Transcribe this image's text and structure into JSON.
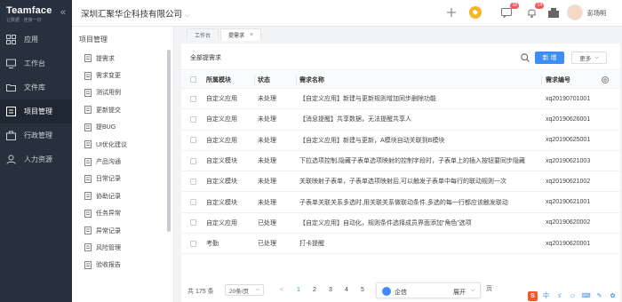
{
  "brand": {
    "name": "Teamface",
    "slogan": "让数据 · 连接一切"
  },
  "nav": {
    "items": [
      {
        "label": "应用",
        "icon": "grid-icon"
      },
      {
        "label": "工作台",
        "icon": "desktop-icon"
      },
      {
        "label": "文件库",
        "icon": "folder-icon"
      },
      {
        "label": "项目管理",
        "icon": "project-icon",
        "active": true
      },
      {
        "label": "行政管理",
        "icon": "admin-icon"
      },
      {
        "label": "人力资源",
        "icon": "people-icon"
      }
    ]
  },
  "topbar": {
    "company": "深圳汇聚华企科技有限公司",
    "badges": {
      "messages": "18",
      "notifications": "14"
    },
    "username": "彭场明"
  },
  "sub": {
    "title": "项目管理",
    "items": [
      "提需求",
      "需求变更",
      "测试用例",
      "更新提交",
      "提BUG",
      "UI优化建议",
      "产品沟通",
      "日常记录",
      "协助记录",
      "任务异常",
      "异常记录",
      "风险管理",
      "验收报告"
    ]
  },
  "tabs": [
    {
      "label": "工作台"
    },
    {
      "label": "提需求"
    }
  ],
  "panel": {
    "title": "全部提需求",
    "new_label": "新 增",
    "more_label": "更多"
  },
  "table": {
    "headers": {
      "module": "所属模块",
      "status": "状态",
      "name": "需求名称",
      "number": "需求编号"
    },
    "rows": [
      {
        "module": "自定义应用",
        "status": "未处理",
        "name": "【自定义应用】新建与更新规则增加同步删除功能",
        "number": "xq20190701001"
      },
      {
        "module": "自定义应用",
        "status": "未处理",
        "name": "【消息提醒】共享数据，无法提醒共享人",
        "number": "xq20190626001"
      },
      {
        "module": "自定义应用",
        "status": "未处理",
        "name": "【自定义应用】新建与更新，A模块自动关联到B模块",
        "number": "xq20190625001"
      },
      {
        "module": "自定义模块",
        "status": "未处理",
        "name": "下拉选项控制,隐藏子表单选项映射的控制字段时，子表单上的插入按钮要同步隐藏",
        "number": "xq20190621003"
      },
      {
        "module": "自定义模块",
        "status": "未处理",
        "name": "关联映射子表单，子表单选项映射后,可以触发子表单中每行的联动规则一次",
        "number": "xq20190621002"
      },
      {
        "module": "自定义模块",
        "status": "未处理",
        "name": "子表单关联关系多选时,用关联关系做联动条件,多选的每一行都应该触发联动",
        "number": "xq20190621001"
      },
      {
        "module": "自定义应用",
        "status": "已处理",
        "name": "【自定义应用】自动化，规则条件选择成员界面添加“角色”选项",
        "number": "xq20190620002"
      },
      {
        "module": "考勤",
        "status": "已处理",
        "name": "打卡提醒",
        "number": "xq20190620001"
      }
    ]
  },
  "pager": {
    "total": "共 175 条",
    "page_size": "20条/页",
    "prev": "<",
    "pages": [
      "1",
      "2",
      "3",
      "4",
      "5"
    ],
    "current": "1",
    "suffix": "页"
  },
  "qixin": {
    "name": "企信",
    "expand": "展开"
  },
  "ime": [
    "中",
    "ゞ",
    "☺",
    "⌨",
    "✎",
    "✿"
  ],
  "colors": {
    "accent": "#3e8df4",
    "nav_bg": "#27313e",
    "badge": "#f25a5a"
  }
}
